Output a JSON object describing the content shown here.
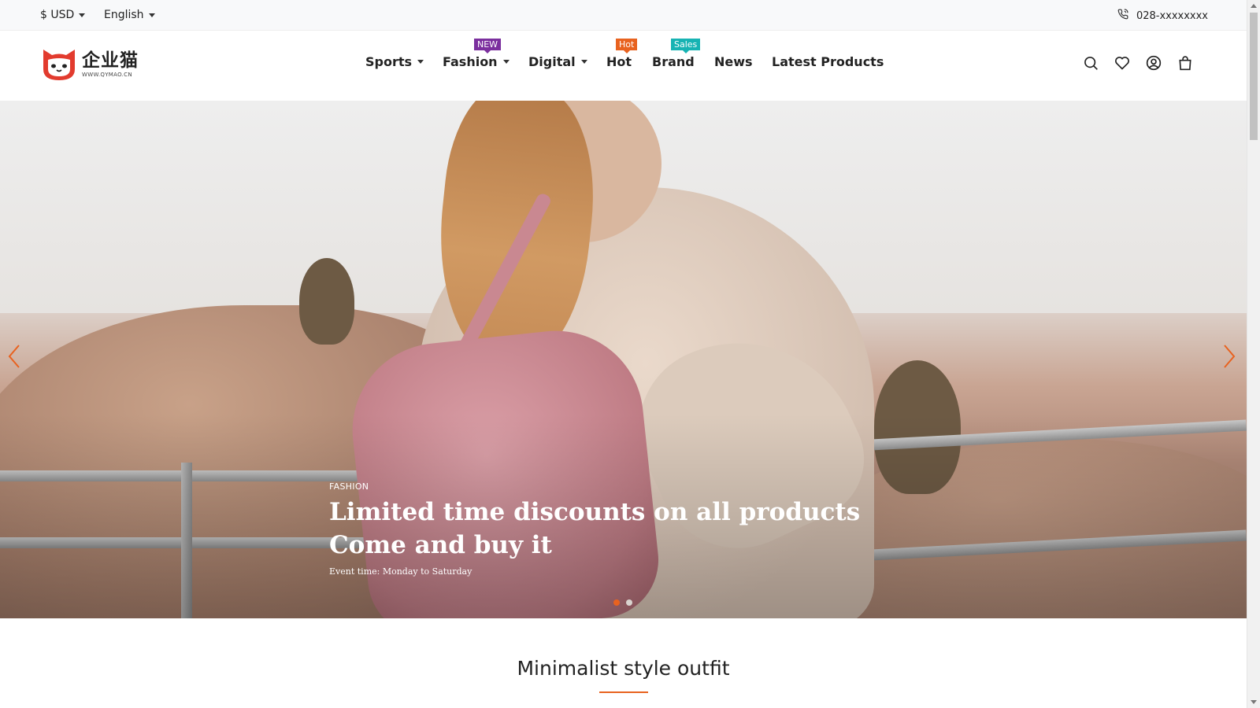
{
  "topbar": {
    "currency": "$ USD",
    "language": "English",
    "phone": "028-xxxxxxxx",
    "phone_icon": "phone-icon"
  },
  "logo": {
    "name": "企业猫",
    "url_text": "WWW.QYMAO.CN"
  },
  "nav": {
    "items": [
      {
        "label": "Sports",
        "dropdown": true
      },
      {
        "label": "Fashion",
        "dropdown": true,
        "badge": "NEW",
        "badge_color": "#7b2f9e"
      },
      {
        "label": "Digital",
        "dropdown": true
      },
      {
        "label": "Hot",
        "dropdown": false,
        "badge": "Hot",
        "badge_color": "#e8621f"
      },
      {
        "label": "Brand",
        "dropdown": false,
        "badge": "Sales",
        "badge_color": "#17b3b3"
      },
      {
        "label": "News",
        "dropdown": false
      },
      {
        "label": "Latest Products",
        "dropdown": false
      }
    ]
  },
  "header_icons": [
    "search-icon",
    "heart-icon",
    "user-icon",
    "shopping-bag-icon"
  ],
  "hero": {
    "tag": "FASHION",
    "title_line1": "Limited time discounts on all products",
    "title_line2": "Come and buy it",
    "subtitle": "Event time: Monday to Saturday",
    "slide_count": 2,
    "active_slide": 1,
    "accent": "#e8621f"
  },
  "section": {
    "title": "Minimalist style outfit"
  }
}
